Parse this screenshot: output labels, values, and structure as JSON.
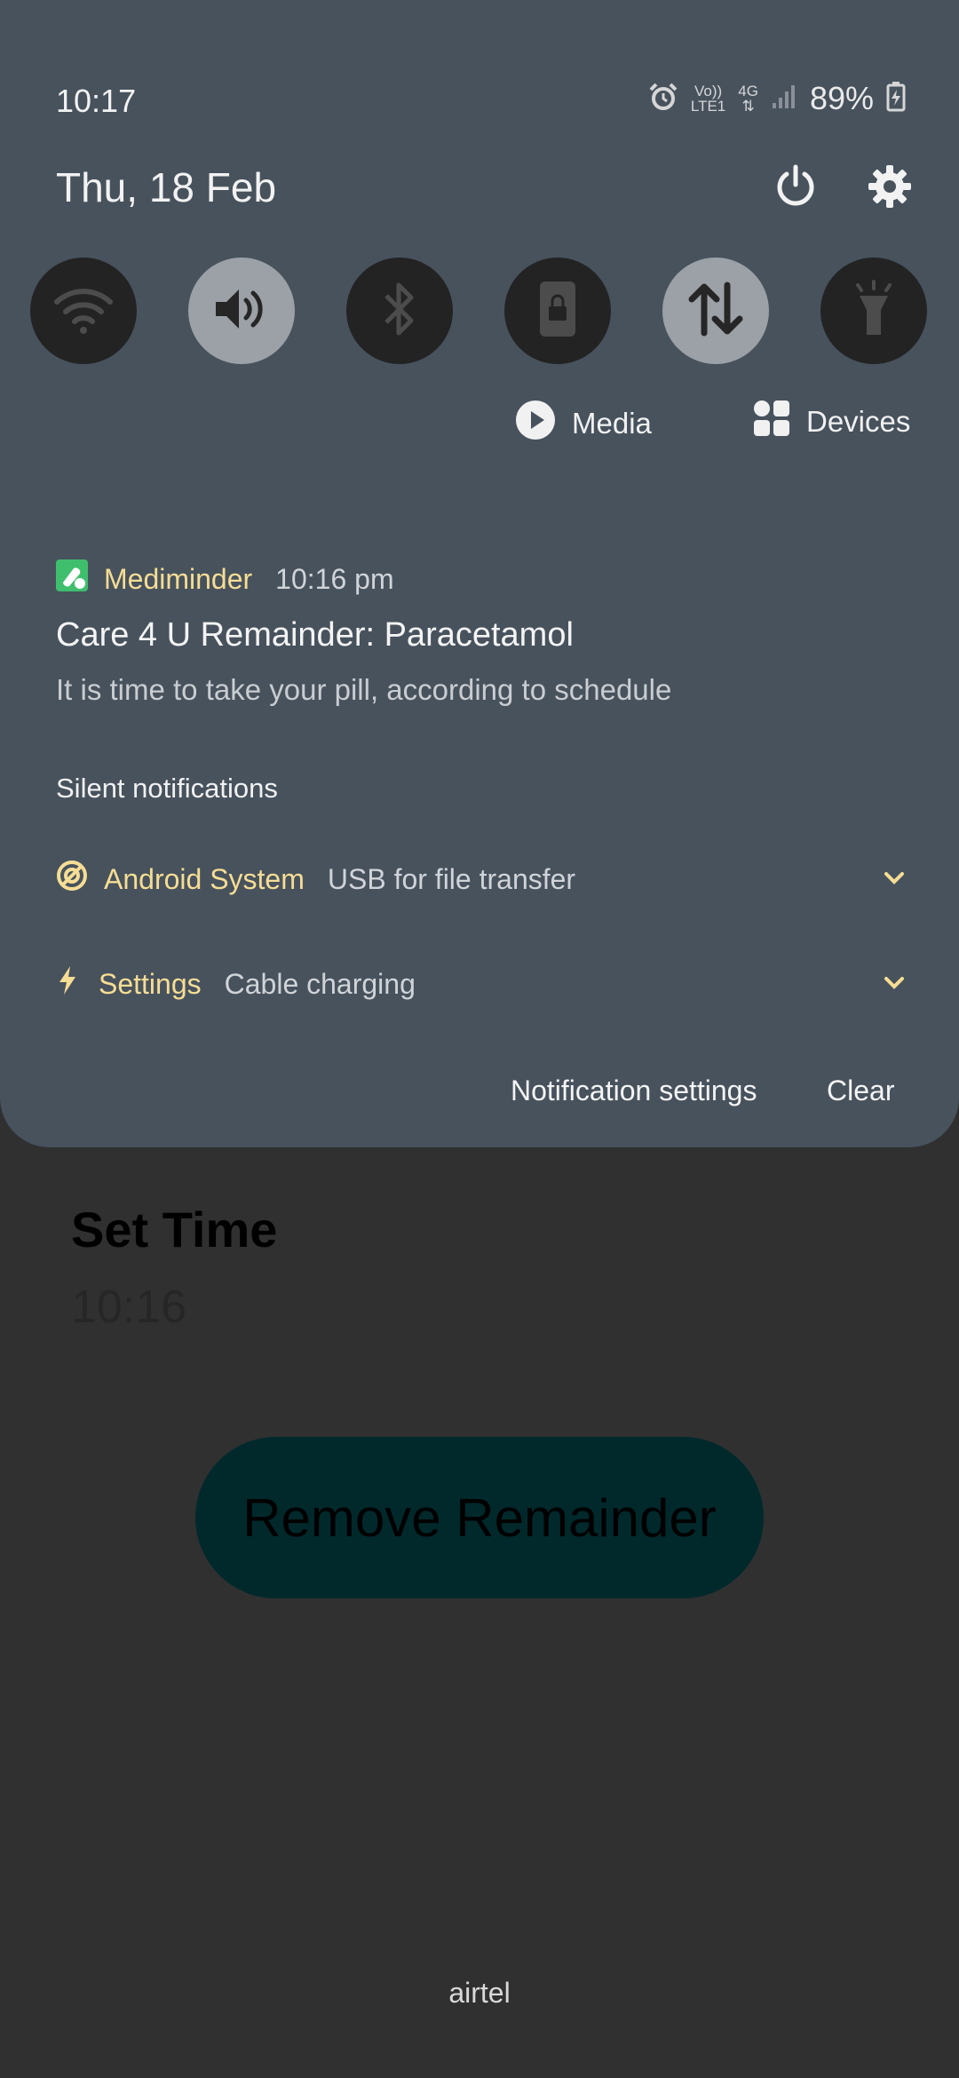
{
  "status_bar": {
    "time": "10:17",
    "volte_top": "Vo))",
    "volte_bottom": "LTE1",
    "network": "4G",
    "battery": "89%"
  },
  "header": {
    "date": "Thu, 18 Feb"
  },
  "quick_settings": {
    "tiles": [
      {
        "name": "wifi",
        "state": "off"
      },
      {
        "name": "sound",
        "state": "on"
      },
      {
        "name": "bluetooth",
        "state": "off"
      },
      {
        "name": "screen-lock",
        "state": "off"
      },
      {
        "name": "mobile-data",
        "state": "on"
      },
      {
        "name": "flashlight",
        "state": "off"
      }
    ],
    "media_label": "Media",
    "devices_label": "Devices"
  },
  "notification": {
    "app": "Mediminder",
    "time": "10:16 pm",
    "title": "Care 4 U Remainder: Paracetamol",
    "text": "It is time to take your pill, according to schedule"
  },
  "silent": {
    "header": "Silent notifications",
    "items": [
      {
        "app": "Android System",
        "text": "USB for file transfer"
      },
      {
        "app": "Settings",
        "text": "Cable charging"
      }
    ]
  },
  "footer": {
    "notification_settings": "Notification settings",
    "clear": "Clear"
  },
  "background_app": {
    "set_time_label": "Set Time",
    "time_value": "10:16",
    "remove_button": "Remove Remainder",
    "carrier": "airtel"
  },
  "colors": {
    "shade": "#47525d",
    "accent": "#f6dd94",
    "app_icon": "#3fbf6e",
    "button_bg": "#01292c"
  }
}
